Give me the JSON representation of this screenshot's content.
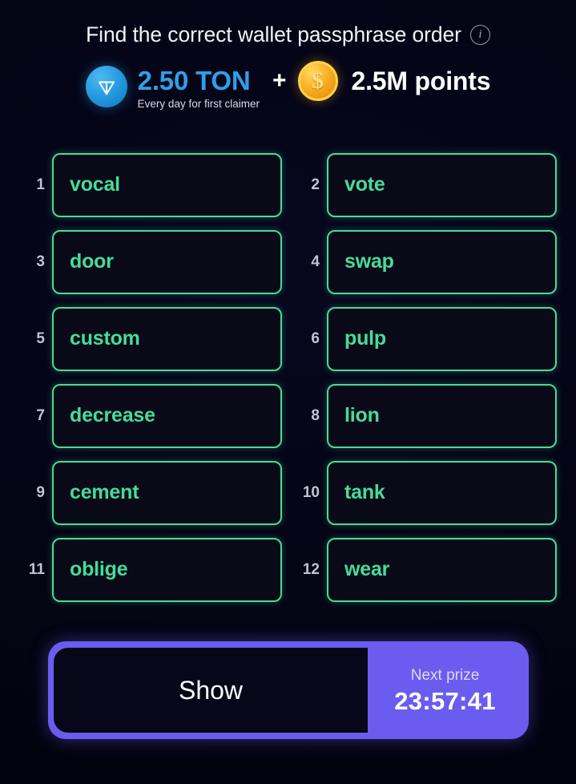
{
  "header": {
    "title": "Find the correct wallet passphrase order",
    "info_icon": "info-icon",
    "info_glyph": "i"
  },
  "prize": {
    "ton_icon": "ton-logo-icon",
    "ton_amount": "2.50 TON",
    "ton_subtitle": "Every day for first claimer",
    "plus": "+",
    "coin_icon": "dollar-coin-icon",
    "coin_glyph": "$",
    "points": "2.5M points",
    "colors": {
      "ton_blue": "#2f9fe8",
      "coin_gold": "#f6a81c",
      "points_white": "#ffffff"
    }
  },
  "words": [
    {
      "index": "1",
      "word": "vocal"
    },
    {
      "index": "2",
      "word": "vote"
    },
    {
      "index": "3",
      "word": "door"
    },
    {
      "index": "4",
      "word": "swap"
    },
    {
      "index": "5",
      "word": "custom"
    },
    {
      "index": "6",
      "word": "pulp"
    },
    {
      "index": "7",
      "word": "decrease"
    },
    {
      "index": "8",
      "word": "lion"
    },
    {
      "index": "9",
      "word": "cement"
    },
    {
      "index": "10",
      "word": "tank"
    },
    {
      "index": "11",
      "word": "oblige"
    },
    {
      "index": "12",
      "word": "wear"
    }
  ],
  "bottom": {
    "show_label": "Show",
    "timer_caption": "Next prize",
    "timer_value": "23:57:41",
    "accent_purple": "#6b5cf0",
    "card_green": "#44dd9a"
  }
}
